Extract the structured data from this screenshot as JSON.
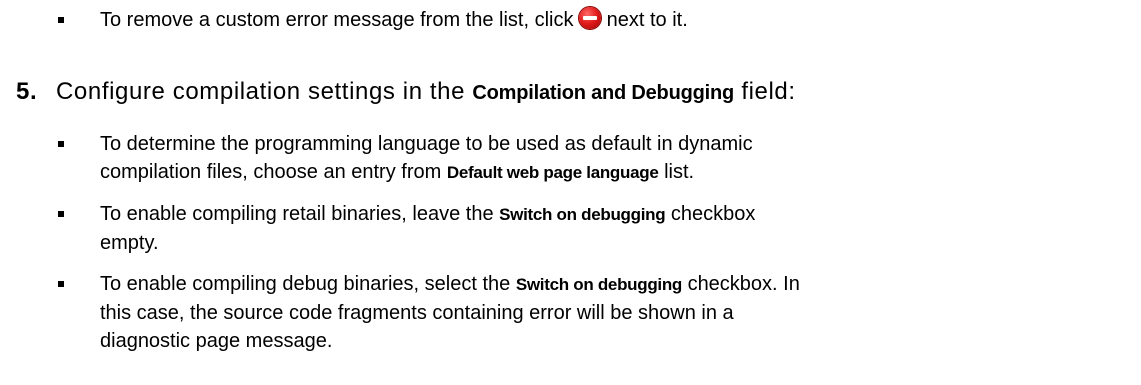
{
  "intro_bullet": {
    "text_before": "To remove a custom error message from the list, click",
    "icon": "remove-red-circle-icon",
    "text_after": "next to it."
  },
  "step": {
    "number": "5.",
    "text_before": "Configure compilation settings in the",
    "field_label": "Compilation and Debugging",
    "text_after": "field:"
  },
  "bullets": [
    {
      "line1_before": "To determine the programming language to be used as default in dynamic",
      "line2_before": "compilation files, choose an entry from",
      "label": "Default web page language",
      "after": "list."
    },
    {
      "line1_before": "To enable compiling retail binaries, leave the",
      "label": "Switch on debugging",
      "after": "checkbox",
      "line2": "empty."
    },
    {
      "line1_before": "To enable compiling debug binaries, select the",
      "label": "Switch on debugging",
      "after": "checkbox. In",
      "line2": "this case, the source code fragments containing error will be shown in a",
      "line3": "diagnostic page message."
    }
  ]
}
